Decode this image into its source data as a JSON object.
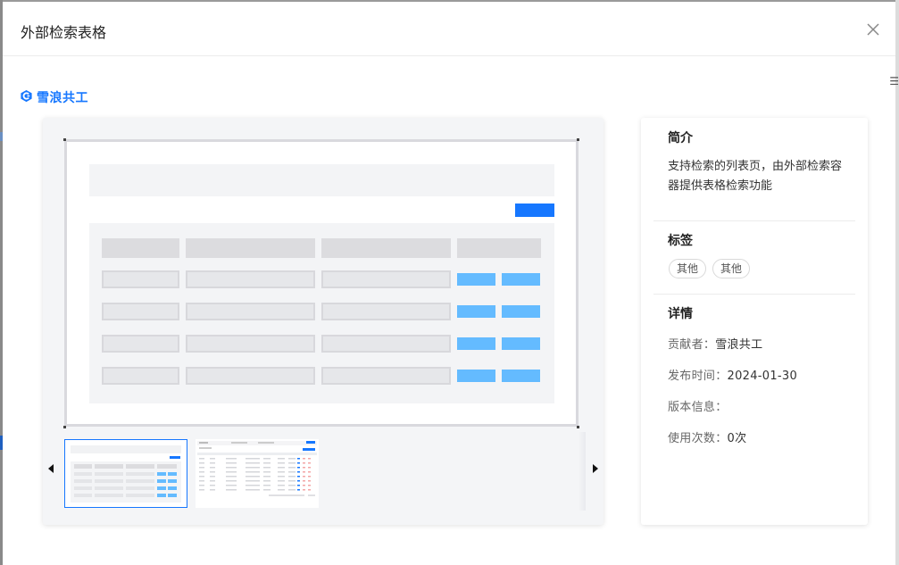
{
  "dialog": {
    "title": "外部检索表格",
    "close_icon": "close-icon"
  },
  "brand": {
    "name": "雪浪共工",
    "logo_icon": "xuelang-logo-icon",
    "color": "#1677ff"
  },
  "preview": {
    "thumbnails": [
      "thumbnail-1",
      "thumbnail-2"
    ],
    "active_thumbnail": 0,
    "prev_icon": "caret-left-icon",
    "next_icon": "caret-right-icon"
  },
  "info": {
    "intro_title": "简介",
    "intro_text": "支持检索的列表页，由外部检索容器提供表格检索功能",
    "tags_title": "标签",
    "tags": [
      "其他",
      "其他"
    ],
    "details_title": "详情",
    "contributor_label": "贡献者：",
    "contributor_value": "雪浪共工",
    "publish_label": "发布时间：",
    "publish_value": "2024-01-30",
    "version_label": "版本信息：",
    "version_value": "",
    "usage_label": "使用次数：",
    "usage_value": "0次"
  }
}
